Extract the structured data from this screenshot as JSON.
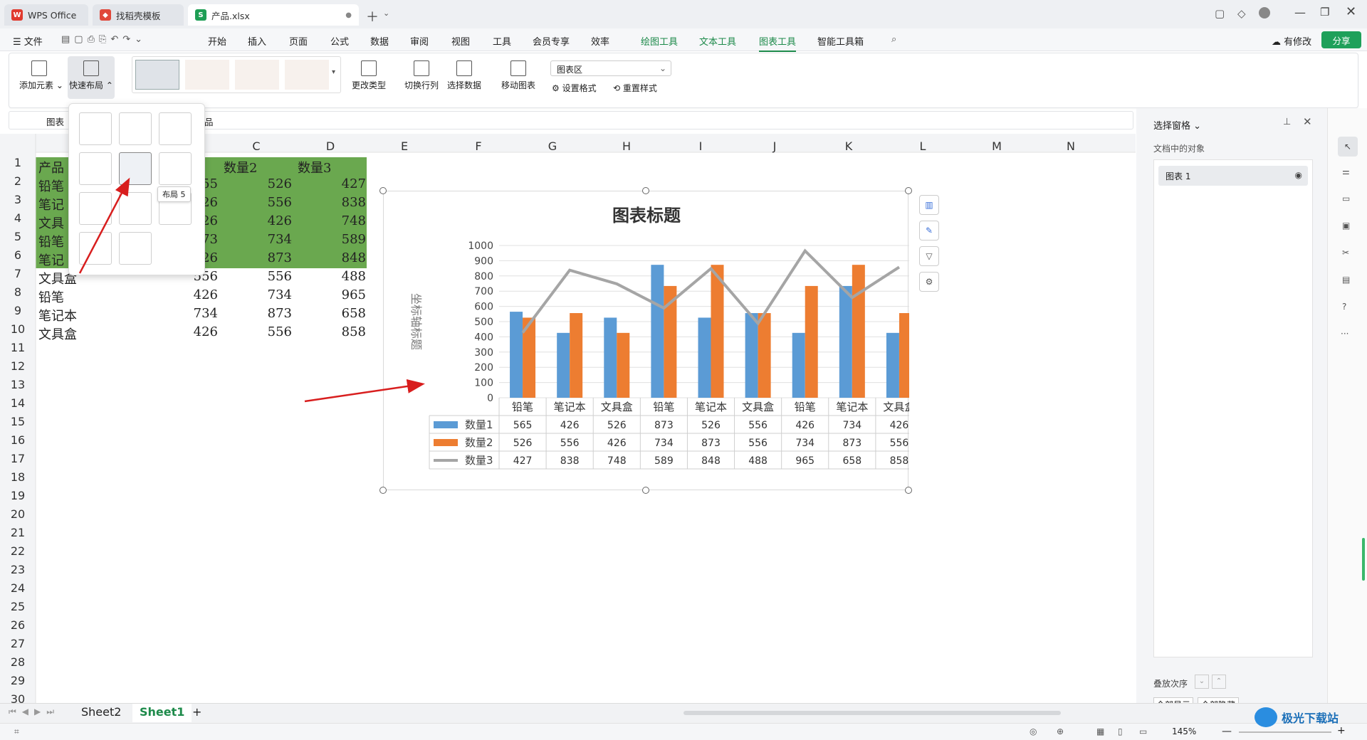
{
  "tabs": [
    {
      "label": "WPS Office"
    },
    {
      "label": "找稻壳模板"
    },
    {
      "label": "产品.xlsx"
    }
  ],
  "menubar": {
    "file": "文件",
    "items": [
      "开始",
      "插入",
      "页面",
      "公式",
      "数据",
      "审阅",
      "视图",
      "工具",
      "会员专享",
      "效率"
    ],
    "green_items": [
      "绘图工具",
      "文本工具",
      "图表工具",
      "智能工具箱"
    ],
    "has_changes": "有修改",
    "share": "分享"
  },
  "ribbon": {
    "add_element": "添加元素",
    "quick_layout": "快速布局",
    "change_type": "更改类型",
    "switch_rowcol": "切换行列",
    "select_data": "选择数据",
    "move_chart": "移动图表",
    "chart_area_select": "图表区",
    "set_format": "设置格式",
    "reset_style": "重置样式"
  },
  "formula": {
    "name_box": "图表",
    "content": "品"
  },
  "tooltip": "布局 5",
  "columns": [
    "C",
    "D",
    "E",
    "F",
    "G",
    "H",
    "I",
    "J",
    "K",
    "L",
    "M",
    "N"
  ],
  "rows": [
    "1",
    "2",
    "3",
    "4",
    "5",
    "6",
    "7",
    "8",
    "9",
    "10",
    "11",
    "12",
    "13",
    "14",
    "15",
    "16",
    "17",
    "18",
    "19",
    "20",
    "21",
    "22",
    "23",
    "24",
    "25",
    "26",
    "27",
    "28",
    "29",
    "30"
  ],
  "sheet": {
    "header": [
      "产品",
      "数量2",
      "数量3"
    ],
    "colA": [
      "铅笔",
      "笔记",
      "文具",
      "铅笔",
      "笔记",
      "文具盒",
      "铅笔",
      "笔记本",
      "文具盒"
    ],
    "colB": [
      "55",
      "26",
      "26",
      "73",
      "26",
      "556",
      "426",
      "734",
      "426"
    ],
    "colC": [
      "526",
      "556",
      "426",
      "734",
      "873",
      "556",
      "734",
      "873",
      "556"
    ],
    "colD": [
      "427",
      "838",
      "748",
      "589",
      "848",
      "488",
      "965",
      "658",
      "858"
    ]
  },
  "chart_data": {
    "type": "bar",
    "title": "图表标题",
    "ylabel": "坐标轴标题",
    "ylim": [
      0,
      1000
    ],
    "yticks": [
      "0",
      "100",
      "200",
      "300",
      "400",
      "500",
      "600",
      "700",
      "800",
      "900",
      "1000"
    ],
    "categories": [
      "铅笔",
      "笔记本",
      "文具盒",
      "铅笔",
      "笔记本",
      "文具盒",
      "铅笔",
      "笔记本",
      "文具盒"
    ],
    "series": [
      {
        "name": "数量1",
        "kind": "bar",
        "color": "#5b9bd5",
        "values": [
          565,
          426,
          526,
          873,
          526,
          556,
          426,
          734,
          426
        ]
      },
      {
        "name": "数量2",
        "kind": "bar",
        "color": "#ed7d31",
        "values": [
          526,
          556,
          426,
          734,
          873,
          556,
          734,
          873,
          556
        ]
      },
      {
        "name": "数量3",
        "kind": "line",
        "color": "#a5a5a5",
        "values": [
          427,
          838,
          748,
          589,
          848,
          488,
          965,
          658,
          858
        ]
      }
    ],
    "data_table": true,
    "grid": true
  },
  "selection_pane": {
    "title": "选择窗格",
    "subtitle": "文档中的对象",
    "item": "图表 1",
    "order_label": "叠放次序",
    "show_all": "全部显示",
    "hide_all": "全部隐藏"
  },
  "sheets": [
    "Sheet2",
    "Sheet1"
  ],
  "status": {
    "zoom": "145%"
  },
  "watermark": "极光下载站"
}
